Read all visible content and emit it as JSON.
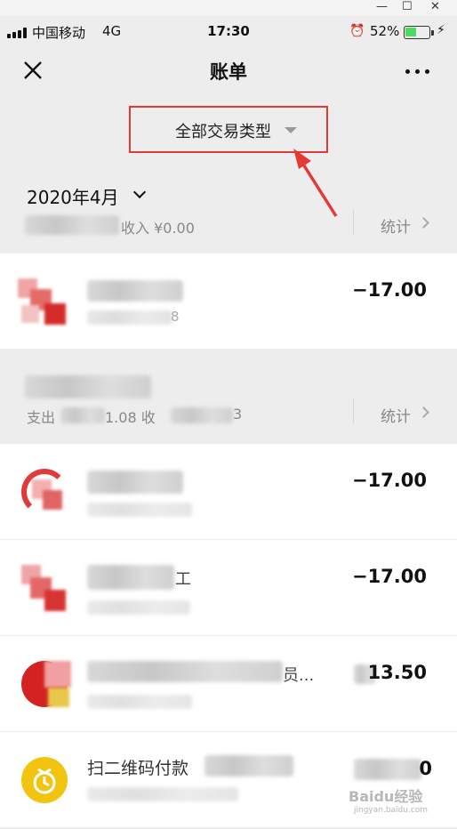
{
  "window": {
    "min": "—",
    "max": "☐",
    "close": "✕"
  },
  "status_bar": {
    "carrier": "中国移动",
    "network": "4G",
    "time": "17:30",
    "alarm_icon": "⏰",
    "battery_pct": "52%",
    "battery_level": 0.52,
    "charging_icon": "⚡"
  },
  "nav": {
    "title": "账单"
  },
  "filter": {
    "label": "全部交易类型"
  },
  "month": {
    "title": "2020年4月",
    "income_label": "收入 ¥0.00",
    "stats_label": "统计"
  },
  "summary2": {
    "prefix": "支出",
    "mid": "1.08  收",
    "tail": "3",
    "stats_label": "统计"
  },
  "transactions": [
    {
      "amount": "−17.00",
      "sub_suffix": "8"
    },
    {
      "amount": "−17.00"
    },
    {
      "amount": "−17.00",
      "name_suffix": "工"
    },
    {
      "amount": "13.50",
      "name_suffix": "员..."
    },
    {
      "amount": "0",
      "name": "扫二维码付款"
    }
  ],
  "watermark": {
    "text": "Baidu经验",
    "sub": "jingyan.baidu.com"
  },
  "colors": {
    "highlight": "#e53935",
    "battery_green": "#4cd964",
    "icon_red": "#e03a3a",
    "icon_yellow": "#f2c40f"
  }
}
